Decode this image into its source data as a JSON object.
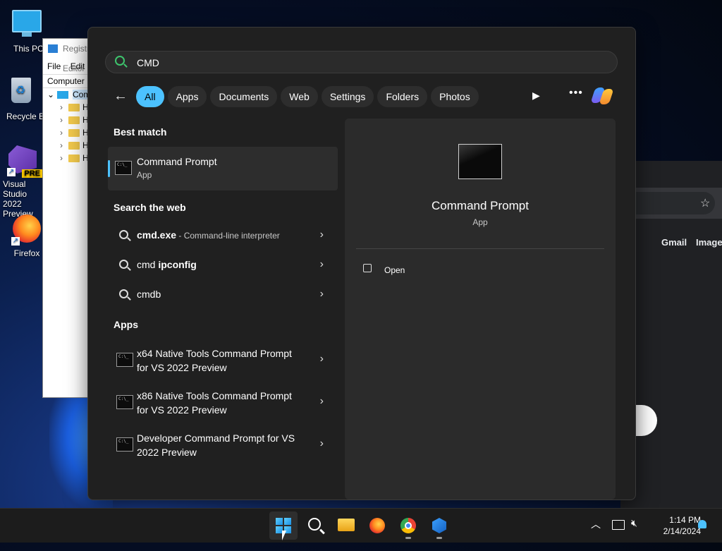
{
  "desktop": {
    "icons": [
      {
        "label": "This PC"
      },
      {
        "label": "Recycle Bin"
      },
      {
        "label": "Visual Studio 2022 Preview",
        "badge": "PRE"
      },
      {
        "label": "Firefox"
      }
    ]
  },
  "registry_window": {
    "title": "Registry Editor",
    "menu": [
      "File",
      "Edit"
    ],
    "address": "Computer",
    "tree_root": "Computer",
    "tree_children": [
      "H",
      "H",
      "H",
      "H",
      "H"
    ]
  },
  "chrome_window": {
    "links": [
      "Gmail",
      "Images"
    ]
  },
  "search": {
    "query": "CMD",
    "filters": [
      "All",
      "Apps",
      "Documents",
      "Web",
      "Settings",
      "Folders",
      "Photos"
    ],
    "active_filter": "All",
    "more_label": "•••"
  },
  "results": {
    "best_match_header": "Best match",
    "best_match": {
      "title": "Command Prompt",
      "type": "App"
    },
    "web_header": "Search the web",
    "web": [
      {
        "bold": "cmd.exe",
        "rest": " - ",
        "sub": "Command-line interpreter"
      },
      {
        "plain": "cmd ",
        "bold": "ipconfig"
      },
      {
        "plain": "cmdb"
      }
    ],
    "apps_header": "Apps",
    "apps": [
      {
        "title": "x64 Native Tools Command Prompt for VS 2022 Preview"
      },
      {
        "title": "x86 Native Tools Command Prompt for VS 2022 Preview"
      },
      {
        "title": "Developer Command Prompt for VS 2022 Preview"
      }
    ]
  },
  "preview": {
    "title": "Command Prompt",
    "type": "App",
    "actions": [
      {
        "label": "Open"
      }
    ]
  },
  "taskbar": {
    "time": "1:14 PM",
    "date": "2/14/2024"
  }
}
